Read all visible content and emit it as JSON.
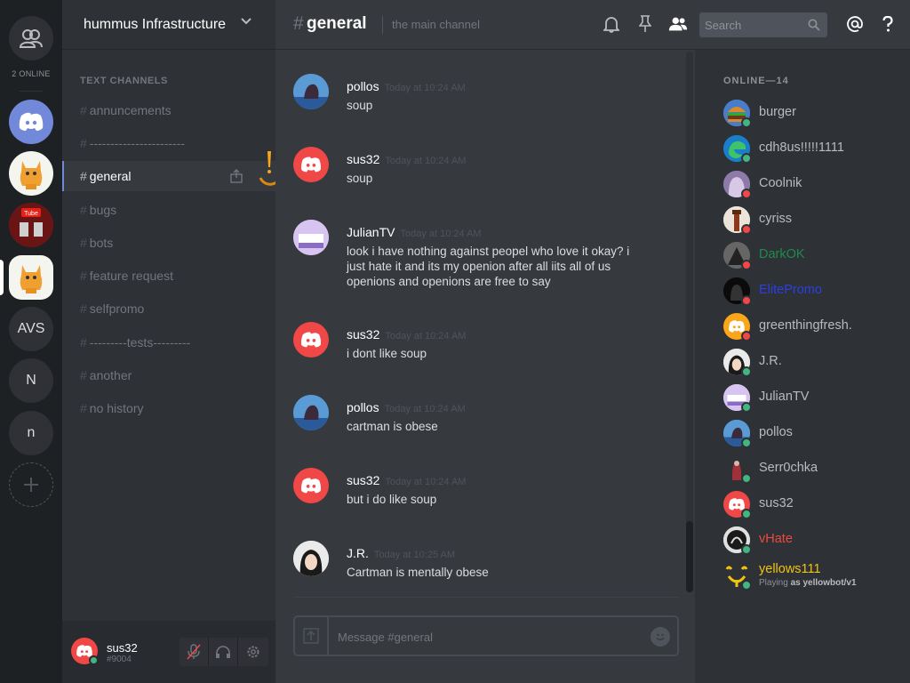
{
  "colors": {
    "accent": "#7289da",
    "online": "#43b581",
    "dnd": "#f04747",
    "role_green": "#1f8b4c",
    "role_blue": "#2c3fe0",
    "role_red": "#e74c3c",
    "role_yellow": "#f1c40f"
  },
  "rail": {
    "online_count": "2 ONLINE",
    "servers": [
      {
        "name": "Discord",
        "icon": "discord-logo-icon"
      },
      {
        "name": "orange cat",
        "icon": "cat-icon"
      },
      {
        "name": "youtube server",
        "icon": "youtube-icon"
      },
      {
        "name": "orange cat active",
        "icon": "cat-icon"
      },
      {
        "name": "AVS",
        "label": "AVS"
      },
      {
        "name": "N",
        "label": "N"
      },
      {
        "name": "n",
        "label": "n"
      }
    ],
    "add_icon": "plus-icon",
    "friends_icon": "friends-icon"
  },
  "guild": {
    "name": "hummus Infrastructure",
    "category": "TEXT CHANNELS",
    "channels": [
      {
        "name": "annuncements"
      },
      {
        "name": "-----------------------"
      },
      {
        "name": "general"
      },
      {
        "name": "bugs"
      },
      {
        "name": "bots"
      },
      {
        "name": "feature request"
      },
      {
        "name": "selfpromo"
      },
      {
        "name": "---------tests---------"
      },
      {
        "name": "another"
      },
      {
        "name": "no history"
      }
    ],
    "selected_channel": "general"
  },
  "user": {
    "name": "sus32",
    "discriminator": "#9004"
  },
  "chat": {
    "hash": "#",
    "channel": "general",
    "topic": "the main channel",
    "search_placeholder": "Search",
    "composer_placeholder": "Message #general",
    "messages": [
      {
        "author": "pollos",
        "time": "Today at 10:24 AM",
        "text": "soup"
      },
      {
        "author": "sus32",
        "time": "Today at 10:24 AM",
        "text": "soup"
      },
      {
        "author": "JulianTV",
        "time": "Today at 10:24 AM",
        "text": "look i have nothing against peopel who love it okay? i just hate it and its my openion after all iits all of us openions and openions are free to say"
      },
      {
        "author": "sus32",
        "time": "Today at 10:24 AM",
        "text": "i dont like soup"
      },
      {
        "author": "pollos",
        "time": "Today at 10:24 AM",
        "text": "cartman is obese"
      },
      {
        "author": "sus32",
        "time": "Today at 10:24 AM",
        "text": "but i do like soup"
      },
      {
        "author": "J.R.",
        "time": "Today at 10:25 AM",
        "text": "Cartman is mentally obese"
      }
    ]
  },
  "members": {
    "header": "ONLINE—14",
    "list": [
      {
        "name": "burger",
        "status": "online"
      },
      {
        "name": "cdh8us!!!!!1111",
        "status": "online"
      },
      {
        "name": "Coolnik",
        "status": "dnd"
      },
      {
        "name": "cyriss",
        "status": "dnd"
      },
      {
        "name": "DarkOK",
        "status": "dnd",
        "role": "role_green"
      },
      {
        "name": "ElitePromo",
        "status": "dnd",
        "role": "role_blue"
      },
      {
        "name": "greenthingfresh.",
        "status": "dnd"
      },
      {
        "name": "J.R.",
        "status": "online"
      },
      {
        "name": "JulianTV",
        "status": "online"
      },
      {
        "name": "pollos",
        "status": "online"
      },
      {
        "name": "Serr0chka",
        "status": "online"
      },
      {
        "name": "sus32",
        "status": "online"
      },
      {
        "name": "vHate",
        "status": "online",
        "role": "role_red"
      },
      {
        "name": "yellows111",
        "status": "online",
        "role": "role_yellow",
        "activity_prefix": "Playing",
        "activity": "as yellowbot/v1"
      }
    ]
  }
}
